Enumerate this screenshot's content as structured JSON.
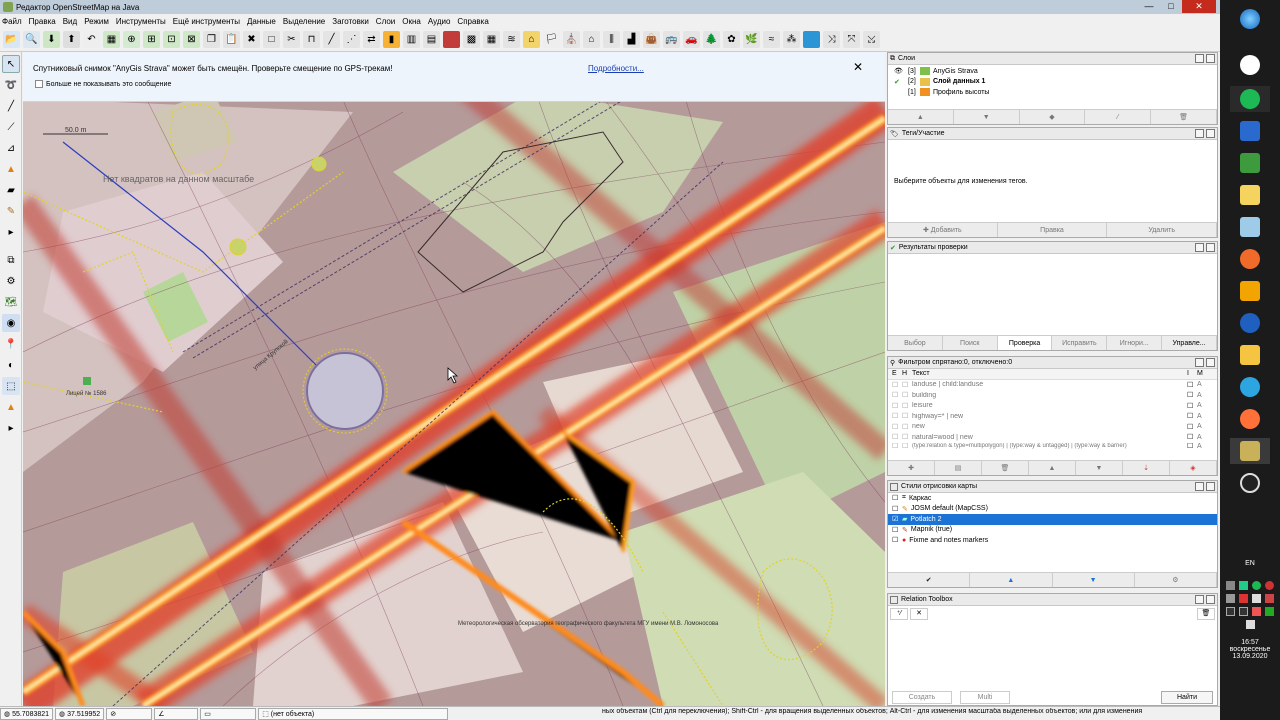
{
  "window": {
    "title": "Редактор OpenStreetMap на Java",
    "min": "—",
    "max": "□",
    "close": "✕"
  },
  "menu": [
    "Файл",
    "Правка",
    "Вид",
    "Режим",
    "Инструменты",
    "Ещё инструменты",
    "Данные",
    "Выделение",
    "Заготовки",
    "Слои",
    "Окна",
    "Аудио",
    "Справка"
  ],
  "notice": {
    "message": "Спутниковый снимок \"AnyGis Strava\" может быть смещён. Проверьте смещение по GPS-трекам!",
    "checkbox": "Больше не показывать это сообщение",
    "link": "Подробности...",
    "close": "✕"
  },
  "map": {
    "scale": "50.0 m",
    "label_no_imagery": "Нет квадратов на данном масштабе",
    "label_school": "Лицей № 1586",
    "label_observatory": "Метеорологическая обсерватория географического факультета МГУ имени М.В. Ломоносова",
    "label_street": "улица Крупской",
    "colors": {
      "heat_core": "#fff6b0",
      "heat_mid": "#ff9a1c",
      "heat_outer": "#e0402a",
      "track": "#8a2a4a"
    }
  },
  "layers": {
    "title": "Слои",
    "items": [
      {
        "num": "[3]",
        "name": "AnyGis Strava",
        "bold": false
      },
      {
        "num": "[2]",
        "name": "Слой данных 1",
        "bold": true
      },
      {
        "num": "[1]",
        "name": "Профиль высоты",
        "bold": false
      }
    ],
    "buttons": [
      "▲",
      "▼",
      "◆",
      "⁄",
      "🗑"
    ]
  },
  "tags": {
    "title": "Теги/Участие",
    "empty": "Выберите объекты для изменения тегов.",
    "buttons": [
      "Добавить",
      "Правка",
      "Удалить"
    ]
  },
  "validation": {
    "title": "Результаты проверки",
    "buttons": [
      "Выбор",
      "Поиск",
      "Проверка",
      "Исправить",
      "Игнори...",
      "Управле..."
    ]
  },
  "filter": {
    "title": "Фильтром спрятано:0, отключено:0",
    "cols": [
      "E",
      "H",
      "Текст",
      "I",
      "M"
    ],
    "rows": [
      "landuse | child:landuse",
      "building",
      "leisure",
      "highway=* | new",
      "new",
      "natural=wood | new",
      "(type:relation & type=multipolygon) | (type:way & untagged) | (type:way & barrier)"
    ],
    "flag": "A"
  },
  "styles": {
    "title": "Стили отрисовки карты",
    "items": [
      {
        "name": "Каркас",
        "checked": false,
        "selected": false
      },
      {
        "name": "JOSM default (MapCSS)",
        "checked": false,
        "selected": false
      },
      {
        "name": "Potlatch 2",
        "checked": true,
        "selected": true
      },
      {
        "name": "Mapnik (true)",
        "checked": false,
        "selected": false
      },
      {
        "name": "Fixme and notes markers",
        "checked": false,
        "selected": false
      }
    ]
  },
  "relation": {
    "title": "Relation Toolbox",
    "buttons": [
      "Создать",
      "Multi",
      "Найти"
    ]
  },
  "status": {
    "lat": "55.7083821",
    "lon": "37.519952",
    "object": "(нет объекта)",
    "help": "ных объектам (Ctrl для переключения); Shift-Ctrl - для вращения выделенных объектов; Alt-Ctrl - для изменения масштаба выделенных объектов; или для изменения"
  },
  "tray": {
    "lang": "EN",
    "time": "16:57",
    "day": "воскресенье",
    "date": "13.09.2020"
  }
}
